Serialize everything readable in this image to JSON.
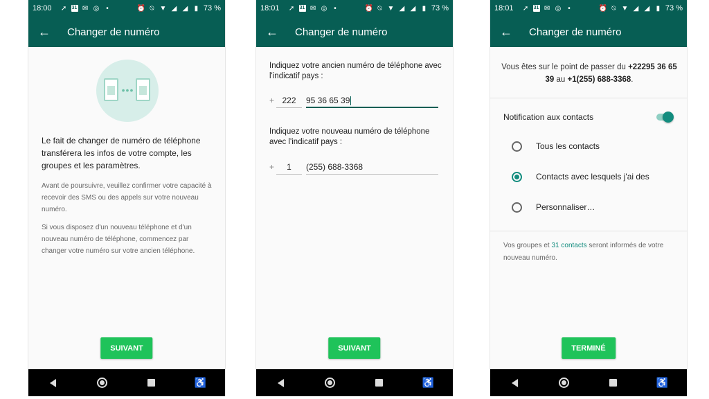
{
  "theme": {
    "header": "#075e54",
    "accent": "#128c7e",
    "button": "#1fc35a"
  },
  "screens": [
    {
      "status": {
        "time": "18:00",
        "battery": "73 %"
      },
      "title": "Changer de numéro",
      "main_text": "Le fait de changer de numéro de téléphone transférera les infos de votre compte, les groupes et les paramètres.",
      "sub_text_1": "Avant de poursuivre, veuillez confirmer votre capacité à recevoir des SMS ou des appels sur votre nouveau numéro.",
      "sub_text_2": "Si vous disposez d'un nouveau téléphone et d'un nouveau numéro de téléphone, commencez par changer votre numéro sur votre ancien téléphone.",
      "button": "SUIVANT"
    },
    {
      "status": {
        "time": "18:01",
        "battery": "73 %"
      },
      "title": "Changer de numéro",
      "old_label": "Indiquez votre ancien numéro de téléphone avec l'indicatif pays :",
      "old_prefix": "+",
      "old_code": "222",
      "old_number": "95 36 65 39",
      "new_label": "Indiquez votre nouveau numéro de téléphone avec l'indicatif pays :",
      "new_prefix": "+",
      "new_code": "1",
      "new_number": "(255) 688-3368",
      "button": "SUIVANT"
    },
    {
      "status": {
        "time": "18:01",
        "battery": "73 %"
      },
      "title": "Changer de numéro",
      "summary_prefix": "Vous êtes sur le point de passer du ",
      "summary_old": "+22295 36 65 39",
      "summary_mid": " au ",
      "summary_new": "+1(255) 688-3368",
      "summary_end": ".",
      "notify_label": "Notification aux contacts",
      "notify_on": true,
      "options": [
        "Tous les contacts",
        "Contacts avec lesquels j'ai des",
        "Personnaliser…"
      ],
      "selected_option": 1,
      "footer_prefix": "Vos groupes et ",
      "footer_link": "31 contacts",
      "footer_suffix": " seront informés de votre nouveau numéro.",
      "button": "TERMINÉ"
    }
  ]
}
